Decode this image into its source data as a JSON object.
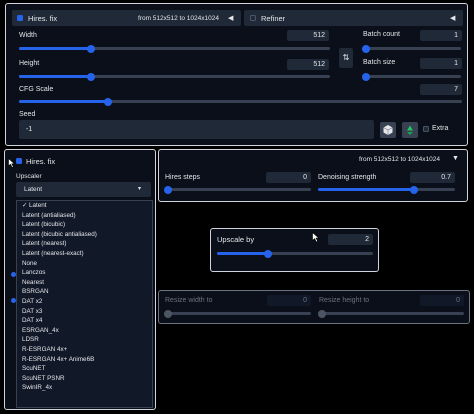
{
  "top": {
    "hires": {
      "checked": true,
      "label": "Hires. fix",
      "from_to": "from 512x512  to 1024x1024",
      "arrow": "◀"
    },
    "refiner": {
      "checked": false,
      "label": "Refiner",
      "arrow": "◀"
    },
    "width": {
      "label": "Width",
      "value": "512",
      "level": 0.23
    },
    "height": {
      "label": "Height",
      "value": "512",
      "level": 0.23
    },
    "swap_icon": "⇅",
    "batch_count": {
      "label": "Batch count",
      "value": "1",
      "level": 0.0
    },
    "batch_size": {
      "label": "Batch size",
      "value": "1",
      "level": 0.0
    },
    "cfg": {
      "label": "CFG Scale",
      "value": "7",
      "level": 0.2
    },
    "seed": {
      "label": "Seed",
      "value": "-1",
      "dice_icon": "dice-icon",
      "recycle_icon": "recycle-icon",
      "extra_label": "Extra"
    }
  },
  "hires_panel": {
    "label": "Hires. fix",
    "upscaler_label": "Upscaler",
    "upscaler_value": "Latent",
    "options": [
      "✓ Latent",
      "Latent (antialiased)",
      "Latent (bicubic)",
      "Latent (bicubic antialiased)",
      "Latent (nearest)",
      "Latent (nearest-exact)",
      "None",
      "Lanczos",
      "Nearest",
      "BSRGAN",
      "DAT x2",
      "DAT x3",
      "DAT x4",
      "ESRGAN_4x",
      "LDSR",
      "R-ESRGAN 4x+",
      "R-ESRGAN 4x+ Anime6B",
      "ScuNET",
      "ScuNET PSNR",
      "SwinIR_4x"
    ]
  },
  "right_panel": {
    "from_to": "from 512x512  to 1024x1024",
    "arrow": "▼",
    "hires_steps": {
      "label": "Hires steps",
      "value": "0",
      "level": 0.0
    },
    "denoise": {
      "label": "Denoising strength",
      "value": "0.7",
      "level": 0.7
    }
  },
  "upscale_panel": {
    "label": "Upscale by",
    "value": "2",
    "level": 0.33
  },
  "resize_panel": {
    "width": {
      "label": "Resize width to",
      "value": "0",
      "level": 0.0
    },
    "height": {
      "label": "Resize height to",
      "value": "0",
      "level": 0.0
    }
  },
  "colors": {
    "accent": "#2563eb",
    "panel_bg": "#0b0f19",
    "field_bg": "#1f2937",
    "recycle": "#22c55e"
  }
}
